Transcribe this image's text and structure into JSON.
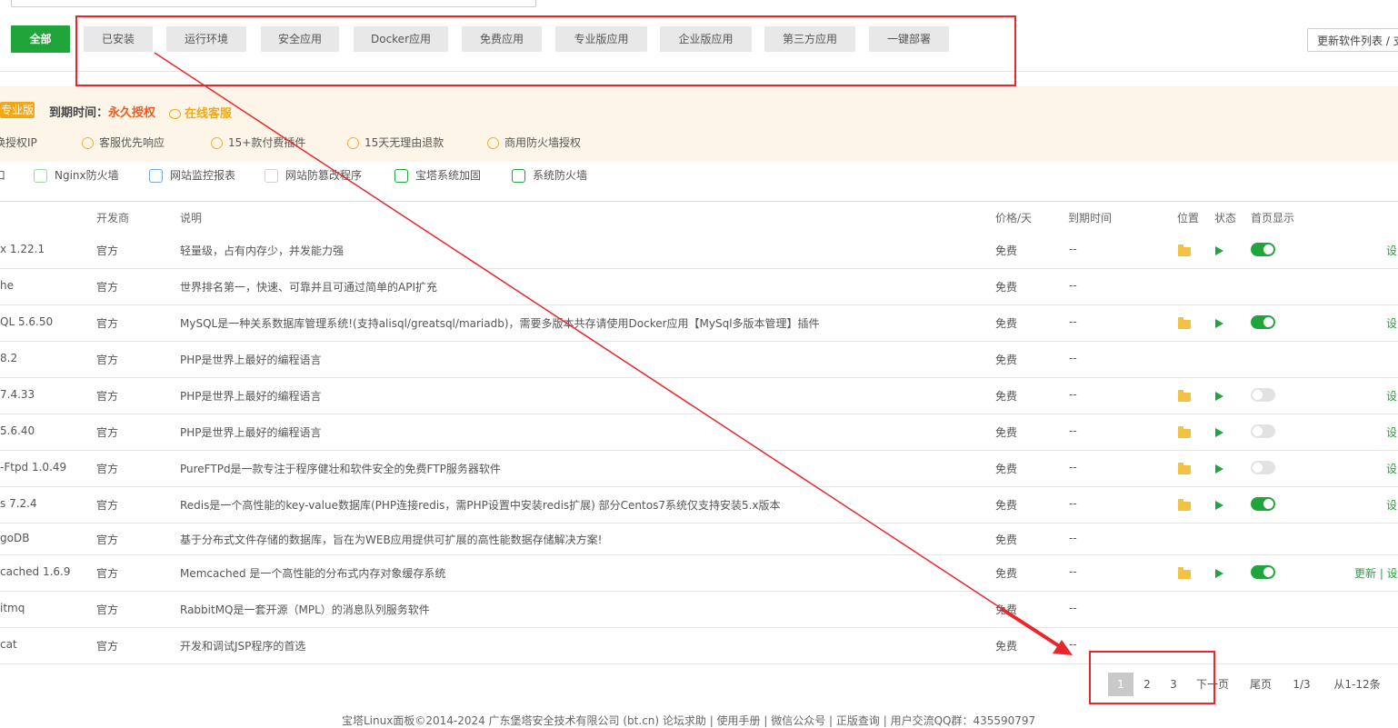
{
  "categories": [
    "全部",
    "已安装",
    "运行环境",
    "安全应用",
    "Docker应用",
    "免费应用",
    "专业版应用",
    "企业版应用",
    "第三方应用",
    "一键部署"
  ],
  "update_button": "更新软件列表 / 支",
  "pro_banner": {
    "badge": "专业版",
    "expire_label": "到期时间：",
    "expire_value": "永久授权",
    "support": "在线客服",
    "features": [
      "换授权IP",
      "客服优先响应",
      "15+款付费插件",
      "15天无理由退款",
      "商用防火墙授权"
    ]
  },
  "plugins": [
    "口",
    "Nginx防火墙",
    "网站监控报表",
    "网站防篡改程序",
    "宝塔系统加固",
    "系统防火墙"
  ],
  "table": {
    "headers": [
      "开发商",
      "说明",
      "价格/天",
      "到期时间",
      "位置",
      "状态",
      "首页显示"
    ],
    "rows": [
      {
        "name": "x 1.22.1",
        "dev": "官方",
        "desc": "轻量级，占有内存少，并发能力强",
        "price": "免费",
        "expire": "--",
        "installed": true,
        "on": true,
        "action": "设"
      },
      {
        "name": "he",
        "dev": "官方",
        "desc": "世界排名第一，快速、可靠并且可通过简单的API扩充",
        "price": "免费",
        "expire": "--",
        "installed": false
      },
      {
        "name": "QL 5.6.50",
        "dev": "官方",
        "desc": "MySQL是一种关系数据库管理系统!(支持alisql/greatsql/mariadb)，需要多版本共存请使用Docker应用【MySql多版本管理】插件",
        "price": "免费",
        "expire": "--",
        "installed": true,
        "on": true,
        "action": "设"
      },
      {
        "name": "8.2",
        "dev": "官方",
        "desc": "PHP是世界上最好的编程语言",
        "price": "免费",
        "expire": "--",
        "installed": false
      },
      {
        "name": "7.4.33",
        "dev": "官方",
        "desc": "PHP是世界上最好的编程语言",
        "price": "免费",
        "expire": "--",
        "installed": true,
        "on": false,
        "action": "设"
      },
      {
        "name": "5.6.40",
        "dev": "官方",
        "desc": "PHP是世界上最好的编程语言",
        "price": "免费",
        "expire": "--",
        "installed": true,
        "on": false,
        "action": "设"
      },
      {
        "name": "-Ftpd 1.0.49",
        "dev": "官方",
        "desc": "PureFTPd是一款专注于程序健壮和软件安全的免费FTP服务器软件",
        "price": "免费",
        "expire": "--",
        "installed": true,
        "on": false,
        "action": "设"
      },
      {
        "name": "s 7.2.4",
        "dev": "官方",
        "desc": "Redis是一个高性能的key-value数据库(PHP连接redis，需PHP设置中安装redis扩展) 部分Centos7系统仅支持安装5.x版本",
        "price": "免费",
        "expire": "--",
        "installed": true,
        "on": true,
        "action": "设"
      },
      {
        "name": "goDB",
        "dev": "官方",
        "desc": "基于分布式文件存储的数据库，旨在为WEB应用提供可扩展的高性能数据存储解决方案!",
        "price": "免费",
        "expire": "--",
        "installed": false
      },
      {
        "name": "cached 1.6.9",
        "dev": "官方",
        "desc": "Memcached 是一个高性能的分布式内存对象缓存系统",
        "price": "免费",
        "expire": "--",
        "installed": true,
        "on": true,
        "action": "更新 | 设"
      },
      {
        "name": "itmq",
        "dev": "官方",
        "desc": "RabbitMQ是一套开源（MPL）的消息队列服务软件",
        "price": "免费",
        "expire": "--",
        "installed": false
      },
      {
        "name": "cat",
        "dev": "官方",
        "desc": "开发和调试JSP程序的首选",
        "price": "免费",
        "expire": "--",
        "installed": false
      }
    ]
  },
  "pagination": {
    "pages": [
      "1",
      "2",
      "3"
    ],
    "next": "下一页",
    "last": "尾页",
    "ratio": "1/3",
    "range": "从1-12条"
  },
  "footer": "宝塔Linux面板©2014-2024 广东堡塔安全技术有限公司 (bt.cn)  论坛求助 | 使用手册 | 微信公众号 | 正版查询 | 用户交流QQ群：435590797",
  "colors": {
    "accent": "#20a53a",
    "pro": "#f0a817",
    "expire": "#f05a20",
    "annotation": "#e8262c"
  }
}
